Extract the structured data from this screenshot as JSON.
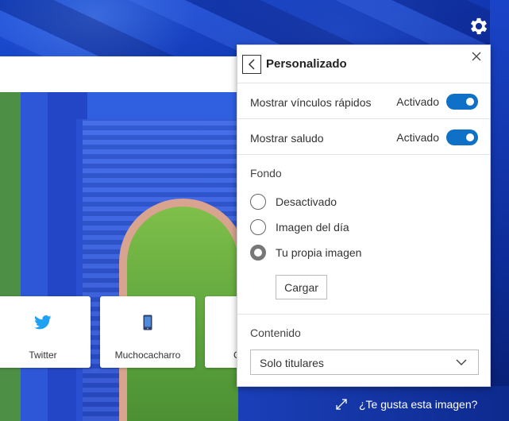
{
  "quick_links": [
    {
      "label": "Twitter",
      "icon": "twitter-icon",
      "color": "#1da1f2"
    },
    {
      "label": "Muchocacharro",
      "icon": "phone-icon",
      "color": "#3b6fb6"
    },
    {
      "label": "C",
      "icon": "",
      "color": ""
    }
  ],
  "panel": {
    "title": "Personalizado",
    "settings": [
      {
        "label": "Mostrar vínculos rápidos",
        "state": "Activado",
        "enabled": true
      },
      {
        "label": "Mostrar saludo",
        "state": "Activado",
        "enabled": true
      }
    ],
    "background": {
      "heading": "Fondo",
      "options": [
        {
          "label": "Desactivado",
          "selected": false
        },
        {
          "label": "Imagen del día",
          "selected": false
        },
        {
          "label": "Tu propia imagen",
          "selected": true
        }
      ],
      "upload_label": "Cargar"
    },
    "content": {
      "heading": "Contenido",
      "selected": "Solo titulares"
    }
  },
  "image_prompt": "¿Te gusta esta imagen?",
  "colors": {
    "accent": "#0f70c8",
    "panel_bg": "#ffffff"
  }
}
